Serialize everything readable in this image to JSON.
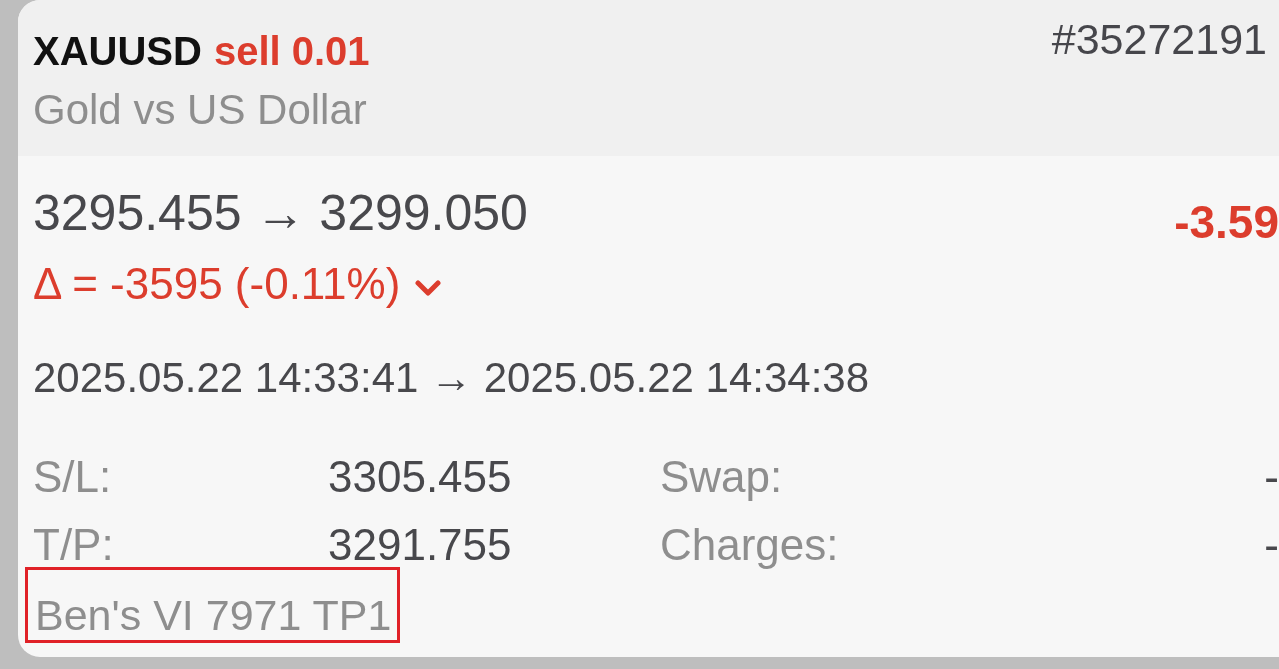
{
  "position": {
    "symbol": "XAUUSD",
    "side": "sell",
    "volume": "0.01",
    "ticket": "#35272191",
    "description": "Gold vs US Dollar",
    "price_line": "3295.455 → 3299.050",
    "profit": "-3.59",
    "delta": {
      "text": "Δ = -3595 (-0.11%)",
      "expanded": false
    },
    "time_line": "2025.05.22 14:33:41 → 2025.05.22 14:34:38",
    "details": [
      {
        "label": "S/L:",
        "value": "3305.455"
      },
      {
        "label": "Swap:",
        "value": "-"
      },
      {
        "label": "T/P:",
        "value": "3291.755"
      },
      {
        "label": "Charges:",
        "value": "-"
      }
    ],
    "comment": {
      "text": "Ben's VI 7971 TP1",
      "highlighted": true
    }
  }
}
